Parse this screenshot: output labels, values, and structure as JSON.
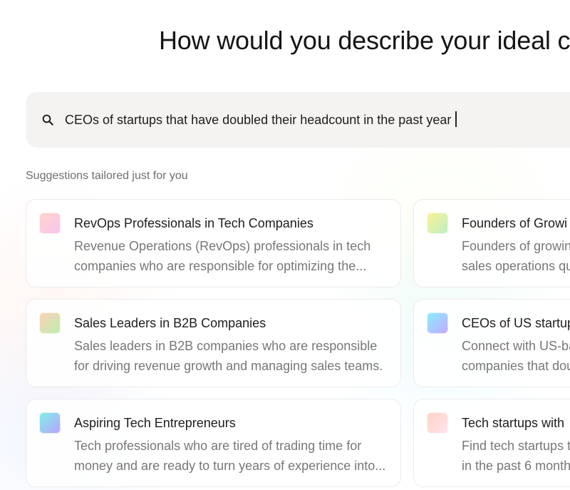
{
  "header": {
    "title": "How would you describe your ideal cus"
  },
  "search": {
    "value": "CEOs of startups that have doubled their headcount in the past year"
  },
  "suggestions": {
    "title": "Suggestions tailored just for you",
    "cards": [
      {
        "title": "RevOps Professionals in Tech Companies",
        "description_lines": [
          "Revenue Operations (RevOps) professionals in tech",
          "companies who are responsible for optimizing the..."
        ],
        "icon": "gradient-square-icon",
        "icon_colors": [
          "#ffd5c8",
          "#f7c4f1"
        ]
      },
      {
        "title": "Founders of Growi",
        "description_lines": [
          "Founders of growin",
          "sales operations qu"
        ],
        "icon": "gradient-square-icon",
        "icon_colors": [
          "#fdf28f",
          "#b9f0c8"
        ]
      },
      {
        "title": "Sales Leaders in B2B Companies",
        "description_lines": [
          "Sales leaders in B2B companies who are responsible",
          "for driving revenue growth and managing sales teams."
        ],
        "icon": "gradient-square-icon",
        "icon_colors": [
          "#ffd0b5",
          "#b8f0b0"
        ]
      },
      {
        "title": "CEOs of US startups",
        "description_lines": [
          "Connect with US-ba",
          "companies that dou"
        ],
        "icon": "gradient-square-icon",
        "icon_colors": [
          "#87f0ff",
          "#c6a6ff"
        ]
      },
      {
        "title": "Aspiring Tech Entrepreneurs",
        "description_lines": [
          "Tech professionals who are tired of trading time for",
          "money and are ready to turn years of experience into..."
        ],
        "icon": "gradient-square-icon",
        "icon_colors": [
          "#7ff0e5",
          "#b9a2ff"
        ]
      },
      {
        "title": "Tech startups with",
        "description_lines": [
          "Find tech startups t",
          "in the past 6 month"
        ],
        "icon": "gradient-square-icon",
        "icon_colors": [
          "#ffd3c5",
          "#ffe4ed"
        ]
      }
    ]
  },
  "colors": {
    "search_background": "#f4f3f1",
    "title_text": "#151515",
    "muted_text": "#777777",
    "card_border": "#eceaea"
  }
}
